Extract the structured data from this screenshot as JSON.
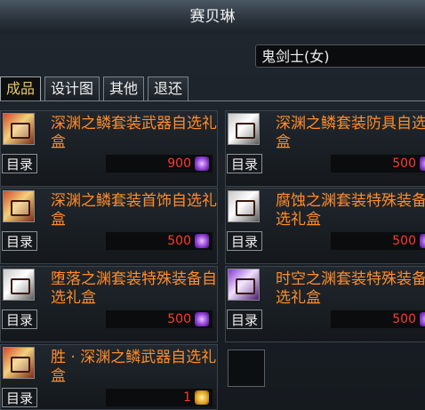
{
  "window": {
    "title": "赛贝琳"
  },
  "job_select": {
    "value": "鬼剑士(女)"
  },
  "tabs": [
    {
      "label": "成品",
      "active": true
    },
    {
      "label": "设计图"
    },
    {
      "label": "其他"
    },
    {
      "label": "退还"
    }
  ],
  "items": [
    {
      "name": "深渊之鳞套装武器自选礼盒",
      "catalog": "目录",
      "price": "900",
      "price_color": "red",
      "currency_icon": "purple-crystal-icon"
    },
    {
      "name": "深渊之鳞套装防具自选礼盒",
      "catalog": "目录",
      "price": "500",
      "price_color": "red",
      "currency_icon": "purple-crystal-icon"
    },
    {
      "name": "深渊之鳞套装首饰自选礼盒",
      "catalog": "目录",
      "price": "500",
      "price_color": "red",
      "currency_icon": "purple-crystal-icon"
    },
    {
      "name": "腐蚀之渊套装特殊装备自选礼盒",
      "catalog": "目录",
      "price": "500",
      "price_color": "red",
      "currency_icon": "purple-crystal-icon"
    },
    {
      "name": "堕落之渊套装特殊装备自选礼盒",
      "catalog": "目录",
      "price": "500",
      "price_color": "red",
      "currency_icon": "purple-crystal-icon"
    },
    {
      "name": "时空之渊套装特殊装备自选礼盒",
      "catalog": "目录",
      "price": "500",
      "price_color": "red",
      "currency_icon": "purple-crystal-icon"
    },
    {
      "name": "胜 · 深渊之鳞武器自选礼盒",
      "catalog": "目录",
      "price": "1",
      "price_color": "red",
      "currency_icon": "gold-crystal-icon"
    }
  ]
}
